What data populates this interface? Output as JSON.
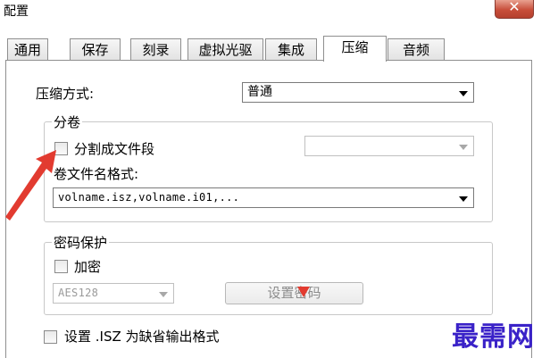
{
  "window": {
    "title": "配置",
    "close_symbol": "✕"
  },
  "tabs": [
    {
      "label": "通用",
      "active": false
    },
    {
      "label": "保存",
      "active": false
    },
    {
      "label": "刻录",
      "active": false
    },
    {
      "label": "虚拟光驱",
      "active": false
    },
    {
      "label": "集成",
      "active": false
    },
    {
      "label": "压缩",
      "active": true
    },
    {
      "label": "音频",
      "active": false
    }
  ],
  "compression": {
    "method_label": "压缩方式:",
    "method_value": "普通"
  },
  "split": {
    "group_title": "分卷",
    "split_checkbox_label": "分割成文件段",
    "split_checked": false,
    "split_size_value": "",
    "filename_format_label": "卷文件名格式:",
    "filename_format_value": "volname.isz,volname.i01,..."
  },
  "password": {
    "group_title": "密码保护",
    "encrypt_checkbox_label": "加密",
    "encrypt_checked": false,
    "algorithm_value": "AES128",
    "set_password_button": "设置密码"
  },
  "default_format": {
    "checkbox_label": "设置 .ISZ 为缺省输出格式",
    "checked": false
  },
  "watermark": {
    "text": "最需网",
    "color": "#3a22c8"
  },
  "colors": {
    "annotation_arrow": "#e23b30",
    "tab_border": "#8f8f8f",
    "close_button": "#c84e3a"
  },
  "icons": [
    "close-icon",
    "chevron-down-icon",
    "annotation-arrow"
  ]
}
